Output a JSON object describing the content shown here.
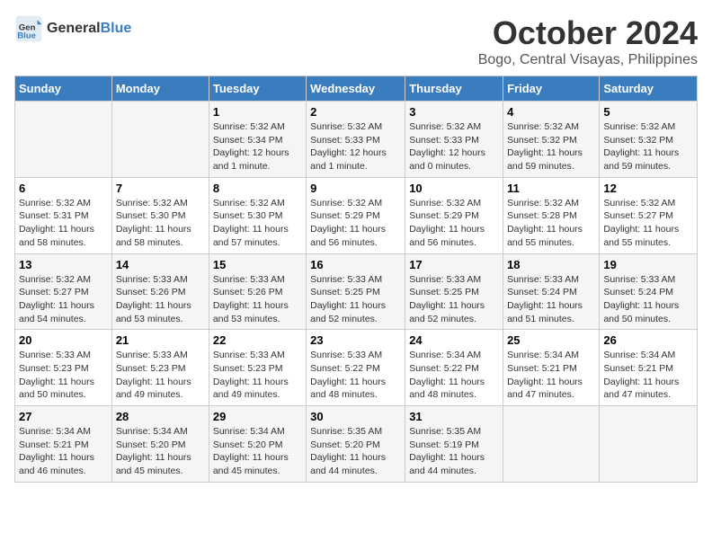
{
  "header": {
    "logo_general": "General",
    "logo_blue": "Blue",
    "month_title": "October 2024",
    "location": "Bogo, Central Visayas, Philippines"
  },
  "days_of_week": [
    "Sunday",
    "Monday",
    "Tuesday",
    "Wednesday",
    "Thursday",
    "Friday",
    "Saturday"
  ],
  "weeks": [
    [
      {
        "day": "",
        "info": ""
      },
      {
        "day": "",
        "info": ""
      },
      {
        "day": "1",
        "info": "Sunrise: 5:32 AM\nSunset: 5:34 PM\nDaylight: 12 hours and 1 minute."
      },
      {
        "day": "2",
        "info": "Sunrise: 5:32 AM\nSunset: 5:33 PM\nDaylight: 12 hours and 1 minute."
      },
      {
        "day": "3",
        "info": "Sunrise: 5:32 AM\nSunset: 5:33 PM\nDaylight: 12 hours and 0 minutes."
      },
      {
        "day": "4",
        "info": "Sunrise: 5:32 AM\nSunset: 5:32 PM\nDaylight: 11 hours and 59 minutes."
      },
      {
        "day": "5",
        "info": "Sunrise: 5:32 AM\nSunset: 5:32 PM\nDaylight: 11 hours and 59 minutes."
      }
    ],
    [
      {
        "day": "6",
        "info": "Sunrise: 5:32 AM\nSunset: 5:31 PM\nDaylight: 11 hours and 58 minutes."
      },
      {
        "day": "7",
        "info": "Sunrise: 5:32 AM\nSunset: 5:30 PM\nDaylight: 11 hours and 58 minutes."
      },
      {
        "day": "8",
        "info": "Sunrise: 5:32 AM\nSunset: 5:30 PM\nDaylight: 11 hours and 57 minutes."
      },
      {
        "day": "9",
        "info": "Sunrise: 5:32 AM\nSunset: 5:29 PM\nDaylight: 11 hours and 56 minutes."
      },
      {
        "day": "10",
        "info": "Sunrise: 5:32 AM\nSunset: 5:29 PM\nDaylight: 11 hours and 56 minutes."
      },
      {
        "day": "11",
        "info": "Sunrise: 5:32 AM\nSunset: 5:28 PM\nDaylight: 11 hours and 55 minutes."
      },
      {
        "day": "12",
        "info": "Sunrise: 5:32 AM\nSunset: 5:27 PM\nDaylight: 11 hours and 55 minutes."
      }
    ],
    [
      {
        "day": "13",
        "info": "Sunrise: 5:32 AM\nSunset: 5:27 PM\nDaylight: 11 hours and 54 minutes."
      },
      {
        "day": "14",
        "info": "Sunrise: 5:33 AM\nSunset: 5:26 PM\nDaylight: 11 hours and 53 minutes."
      },
      {
        "day": "15",
        "info": "Sunrise: 5:33 AM\nSunset: 5:26 PM\nDaylight: 11 hours and 53 minutes."
      },
      {
        "day": "16",
        "info": "Sunrise: 5:33 AM\nSunset: 5:25 PM\nDaylight: 11 hours and 52 minutes."
      },
      {
        "day": "17",
        "info": "Sunrise: 5:33 AM\nSunset: 5:25 PM\nDaylight: 11 hours and 52 minutes."
      },
      {
        "day": "18",
        "info": "Sunrise: 5:33 AM\nSunset: 5:24 PM\nDaylight: 11 hours and 51 minutes."
      },
      {
        "day": "19",
        "info": "Sunrise: 5:33 AM\nSunset: 5:24 PM\nDaylight: 11 hours and 50 minutes."
      }
    ],
    [
      {
        "day": "20",
        "info": "Sunrise: 5:33 AM\nSunset: 5:23 PM\nDaylight: 11 hours and 50 minutes."
      },
      {
        "day": "21",
        "info": "Sunrise: 5:33 AM\nSunset: 5:23 PM\nDaylight: 11 hours and 49 minutes."
      },
      {
        "day": "22",
        "info": "Sunrise: 5:33 AM\nSunset: 5:23 PM\nDaylight: 11 hours and 49 minutes."
      },
      {
        "day": "23",
        "info": "Sunrise: 5:33 AM\nSunset: 5:22 PM\nDaylight: 11 hours and 48 minutes."
      },
      {
        "day": "24",
        "info": "Sunrise: 5:34 AM\nSunset: 5:22 PM\nDaylight: 11 hours and 48 minutes."
      },
      {
        "day": "25",
        "info": "Sunrise: 5:34 AM\nSunset: 5:21 PM\nDaylight: 11 hours and 47 minutes."
      },
      {
        "day": "26",
        "info": "Sunrise: 5:34 AM\nSunset: 5:21 PM\nDaylight: 11 hours and 47 minutes."
      }
    ],
    [
      {
        "day": "27",
        "info": "Sunrise: 5:34 AM\nSunset: 5:21 PM\nDaylight: 11 hours and 46 minutes."
      },
      {
        "day": "28",
        "info": "Sunrise: 5:34 AM\nSunset: 5:20 PM\nDaylight: 11 hours and 45 minutes."
      },
      {
        "day": "29",
        "info": "Sunrise: 5:34 AM\nSunset: 5:20 PM\nDaylight: 11 hours and 45 minutes."
      },
      {
        "day": "30",
        "info": "Sunrise: 5:35 AM\nSunset: 5:20 PM\nDaylight: 11 hours and 44 minutes."
      },
      {
        "day": "31",
        "info": "Sunrise: 5:35 AM\nSunset: 5:19 PM\nDaylight: 11 hours and 44 minutes."
      },
      {
        "day": "",
        "info": ""
      },
      {
        "day": "",
        "info": ""
      }
    ]
  ]
}
